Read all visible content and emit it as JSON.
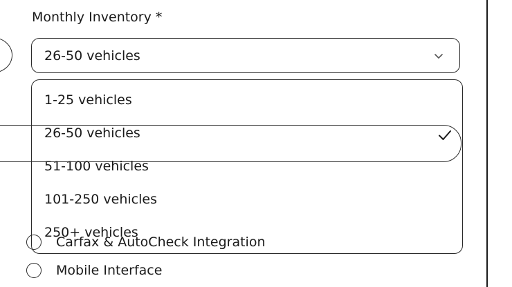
{
  "field": {
    "label": "Monthly Inventory *",
    "selected_value": "26-50 vehicles"
  },
  "dropdown": {
    "options": [
      {
        "label": "1-25 vehicles"
      },
      {
        "label": "26-50 vehicles",
        "selected": true
      },
      {
        "label": "51-100 vehicles"
      },
      {
        "label": "101-250 vehicles"
      },
      {
        "label": "250+ vehicles"
      }
    ]
  },
  "features": [
    {
      "label": "Carfax & AutoCheck Integration"
    },
    {
      "label": "Mobile Interface"
    }
  ],
  "icons": {
    "chevron": "chevron-down-icon",
    "check": "check-icon"
  },
  "colors": {
    "border": "#2a2a2a",
    "text": "#1a1a1a",
    "background": "#ffffff"
  }
}
